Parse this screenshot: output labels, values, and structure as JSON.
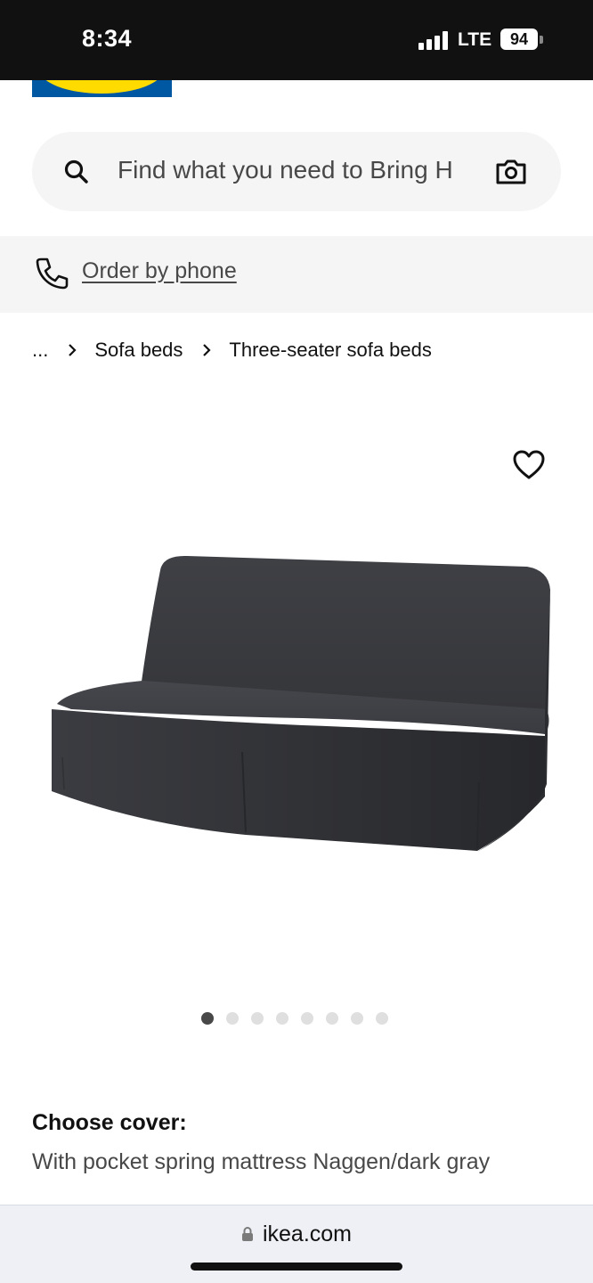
{
  "status_bar": {
    "time": "8:34",
    "network": "LTE",
    "battery": "94"
  },
  "search": {
    "placeholder": "Find what you need to Bring H",
    "icon": "search-icon",
    "camera_icon": "camera-icon"
  },
  "order_by_phone": {
    "label": "Order by phone",
    "icon": "phone-icon"
  },
  "breadcrumb": {
    "ellipsis": "...",
    "items": [
      "Sofa beds",
      "Three-seater sofa beds"
    ]
  },
  "product": {
    "favorite_icon": "heart-icon",
    "image_count": 8,
    "active_image_index": 0
  },
  "cover": {
    "label": "Choose cover:",
    "value": "With pocket spring mattress Naggen/dark gray"
  },
  "browser": {
    "url": "ikea.com"
  },
  "colors": {
    "ikea_blue": "#0058a3",
    "ikea_yellow": "#ffdb00",
    "sofa_gray": "#3b3c40"
  }
}
